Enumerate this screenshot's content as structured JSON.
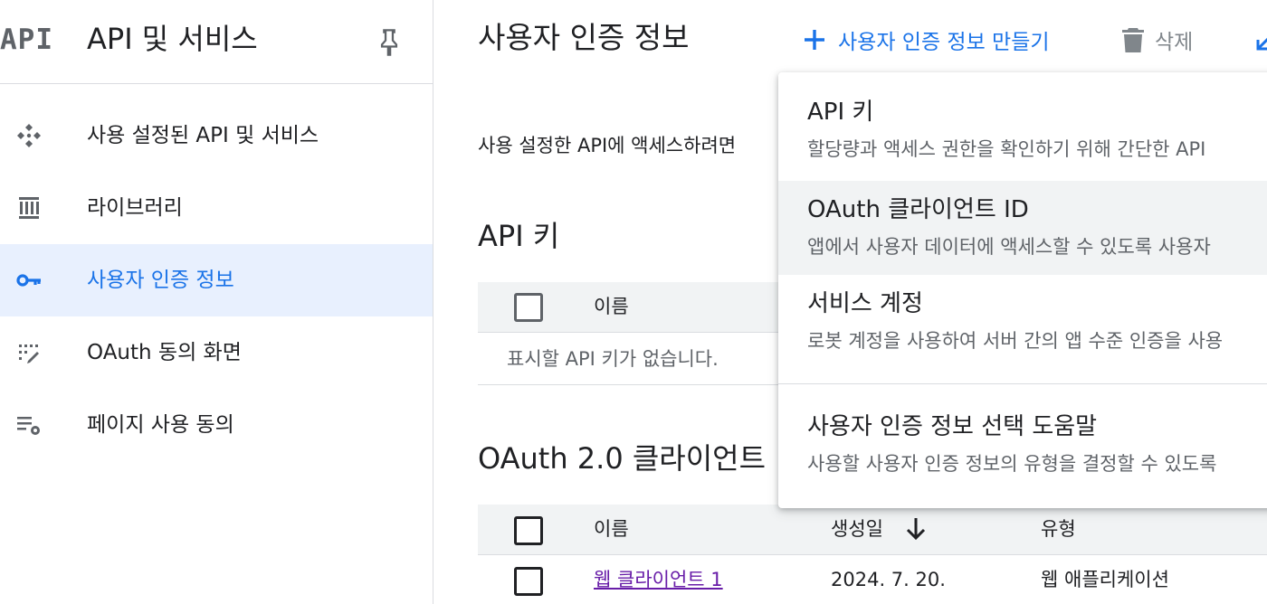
{
  "sidebar": {
    "logo_text": "API",
    "title": "API 및 서비스",
    "items": [
      {
        "label": "사용 설정된 API 및 서비스",
        "icon": "api-services-icon",
        "active": false
      },
      {
        "label": "라이브러리",
        "icon": "library-icon",
        "active": false
      },
      {
        "label": "사용자 인증 정보",
        "icon": "key-icon",
        "active": true
      },
      {
        "label": "OAuth 동의 화면",
        "icon": "oauth-consent-icon",
        "active": false
      },
      {
        "label": "페이지 사용 동의",
        "icon": "page-agreement-icon",
        "active": false
      }
    ]
  },
  "header": {
    "title": "사용자 인증 정보",
    "create_label": "사용자 인증 정보 만들기",
    "delete_label": "삭제"
  },
  "main": {
    "intro": "사용 설정한 API에 액세스하려면",
    "api_keys": {
      "title": "API 키",
      "columns": [
        "이름"
      ],
      "empty_text": "표시할 API 키가 없습니다."
    },
    "oauth": {
      "title": "OAuth 2.0 클라이언트",
      "columns": [
        "이름",
        "생성일",
        "유형"
      ],
      "rows": [
        {
          "name": "웹 클라이언트 1",
          "created": "2024. 7. 20.",
          "type": "웹 애플리케이션"
        }
      ]
    }
  },
  "menu": {
    "items": [
      {
        "title": "API 키",
        "description": "할당량과 액세스 권한을 확인하기 위해 간단한 API"
      },
      {
        "title": "OAuth 클라이언트 ID",
        "description": "앱에서 사용자 데이터에 액세스할 수 있도록 사용자"
      },
      {
        "title": "서비스 계정",
        "description": "로봇 계정을 사용하여 서버 간의 앱 수준 인증을 사용"
      },
      {
        "title": "사용자 인증 정보 선택 도움말",
        "description": "사용할 사용자 인증 정보의 유형을 결정할 수 있도록"
      }
    ]
  },
  "colors": {
    "accent": "#1a73e8",
    "active_bg": "#e8f0fe",
    "link_visited": "#681da8",
    "muted": "#5f6368"
  }
}
